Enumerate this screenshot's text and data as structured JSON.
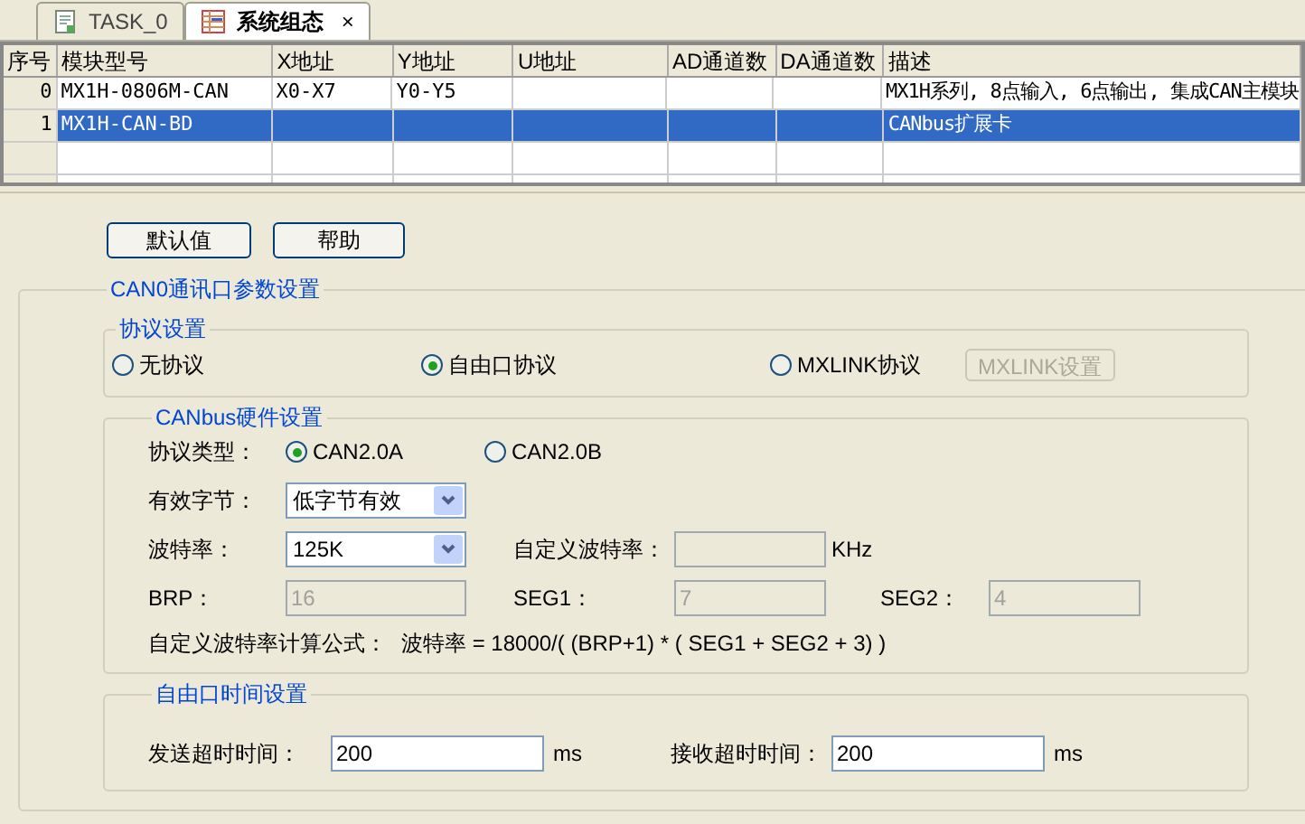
{
  "tabs": [
    {
      "label": "TASK_0",
      "selected": false,
      "kind": "task"
    },
    {
      "label": "系统组态",
      "selected": true,
      "kind": "config"
    }
  ],
  "close_glyph": "×",
  "table": {
    "columns": [
      "序号",
      "模块型号",
      "X地址",
      "Y地址",
      "U地址",
      "AD通道数",
      "DA通道数",
      "描述"
    ],
    "rows": [
      {
        "selected": false,
        "cells": [
          "0",
          "MX1H-0806M-CAN",
          "X0-X7",
          "Y0-Y5",
          "",
          "",
          "",
          "MX1H系列, 8点输入, 6点输出, 集成CAN主模块"
        ]
      },
      {
        "selected": true,
        "cells": [
          "1",
          "MX1H-CAN-BD",
          "",
          "",
          "",
          "",
          "",
          "CANbus扩展卡"
        ]
      }
    ]
  },
  "buttons": [
    "默认值",
    "帮助"
  ],
  "port_group": {
    "title": "CAN0通讯口参数设置",
    "protocol": {
      "title": "协议设置",
      "options": [
        {
          "label": "无协议",
          "selected": false
        },
        {
          "label": "自由口协议",
          "selected": true
        },
        {
          "label": "MXLINK协议",
          "selected": false
        }
      ],
      "setting_button": {
        "label": "MXLINK设置",
        "disabled": true
      }
    },
    "hardware": {
      "title": "CANbus硬件设置",
      "protocol_type": {
        "label": "协议类型：",
        "options": [
          {
            "label": "CAN2.0A",
            "selected": true
          },
          {
            "label": "CAN2.0B",
            "selected": false
          }
        ]
      },
      "valid_bytes": {
        "label": "有效字节：",
        "value": "低字节有效"
      },
      "baud_rate": {
        "label": "波特率：",
        "value": "125K"
      },
      "custom_baud": {
        "label": "自定义波特率：",
        "unit": "KHz",
        "disabled": true
      },
      "brp": {
        "label": "BRP：",
        "value": "16",
        "disabled": true
      },
      "seg1": {
        "label": "SEG1：",
        "value": "7",
        "disabled": true
      },
      "seg2": {
        "label": "SEG2：",
        "value": "4",
        "disabled": true
      },
      "formula": {
        "label": "自定义波特率计算公式：",
        "text": "波特率 = 18000/( (BRP+1) * ( SEG1 + SEG2 + 3) )"
      }
    },
    "timing": {
      "title": "自由口时间设置",
      "send": {
        "label": "发送超时时间：",
        "value": "200",
        "unit": "ms"
      },
      "receive": {
        "label": "接收超时时间：",
        "value": "200",
        "unit": "ms"
      }
    }
  }
}
